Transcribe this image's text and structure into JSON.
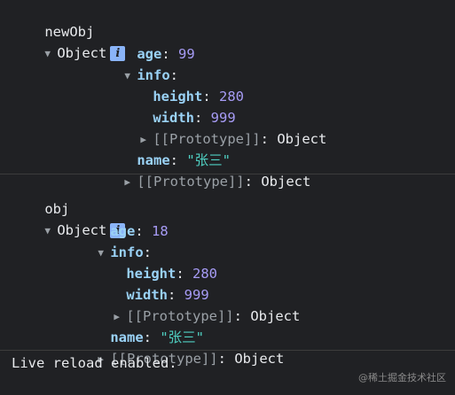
{
  "entries": [
    {
      "name": "newObj",
      "summary": "Object",
      "age_key": "age",
      "age": "99",
      "info_key": "info",
      "height_key": "height",
      "height": "280",
      "width_key": "width",
      "width": "999",
      "proto_label": "[[Prototype]]",
      "proto_value": "Object",
      "name_key": "name",
      "name_value": "\"张三\""
    },
    {
      "name": "obj",
      "summary": "Object",
      "age_key": "age",
      "age": "18",
      "info_key": "info",
      "height_key": "height",
      "height": "280",
      "width_key": "width",
      "width": "999",
      "proto_label": "[[Prototype]]",
      "proto_value": "Object",
      "name_key": "name",
      "name_value": "\"张三\""
    }
  ],
  "info_icon_glyph": "i",
  "status_message": "Live reload enabled.",
  "watermark": "@稀土掘金技术社区",
  "colors": {
    "background": "#202124",
    "key": "#9ad2f6",
    "number": "#a79cf6",
    "string": "#4fd0c2",
    "info_icon": "#8ab4f8"
  },
  "icons": [
    "expand-arrow-icon",
    "collapse-arrow-icon",
    "info-icon"
  ]
}
